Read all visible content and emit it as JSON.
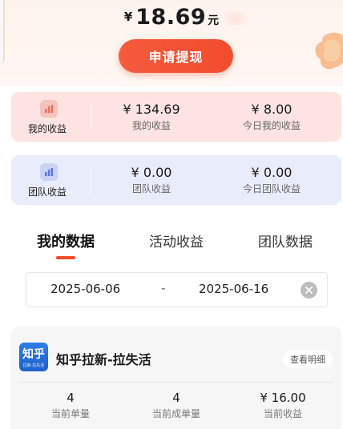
{
  "balance": {
    "currency": "¥",
    "amount": "18.69",
    "unit": "元"
  },
  "withdraw_label": "申请提现",
  "my_earnings": {
    "label": "我的收益",
    "total_value": "¥ 134.69",
    "total_label": "我的收益",
    "today_value": "¥ 8.00",
    "today_label": "今日我的收益"
  },
  "team_earnings": {
    "label": "团队收益",
    "total_value": "¥ 0.00",
    "total_label": "团队收益",
    "today_value": "¥ 0.00",
    "today_label": "今日团队收益"
  },
  "tabs": [
    {
      "label": "我的数据",
      "active": true
    },
    {
      "label": "活动收益",
      "active": false
    },
    {
      "label": "团队数据",
      "active": false
    }
  ],
  "date_range": {
    "start": "2025-06-06",
    "separator": "-",
    "end": "2025-06-16"
  },
  "activity": {
    "logo_text": "知乎",
    "logo_subtext": "拉新·拉失活",
    "title": "知乎拉新-拉失活",
    "detail_label": "查看明细",
    "stats": [
      {
        "value": "4",
        "label": "当前单量"
      },
      {
        "value": "4",
        "label": "当前成单量"
      },
      {
        "value": "¥ 16.00",
        "label": "当前收益"
      }
    ]
  },
  "colors": {
    "accent": "#f24c2d",
    "mine_card_bg": "#fde3e1",
    "team_card_bg": "#e9edfb",
    "logo_blue": "#1e62c9"
  },
  "icons": {
    "mine": "bar-chart-icon",
    "team": "bar-chart-icon",
    "clear": "clear-icon"
  }
}
